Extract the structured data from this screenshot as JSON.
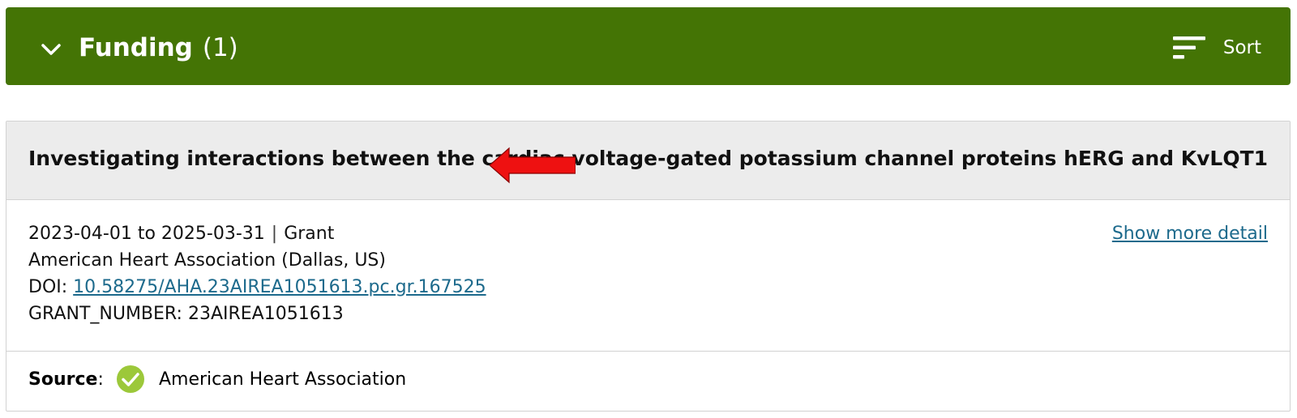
{
  "section": {
    "title": "Funding",
    "count": "(1)",
    "header_color": "#447405",
    "sort_label": "Sort",
    "icons": {
      "collapse": "chevron-down-icon",
      "sort": "sort-lines-icon"
    }
  },
  "funding_item": {
    "title": "Investigating interactions between the cardiac voltage-gated potassium channel proteins hERG and KvLQT1",
    "date_range": "2023-04-01 to 2025-03-31",
    "separator": "|",
    "type": "Grant",
    "organization": "American Heart Association (Dallas, US)",
    "doi_label": "DOI:",
    "doi_value": "10.58275/AHA.23AIREA1051613.pc.gr.167525",
    "grant_number_label": "GRANT_NUMBER:",
    "grant_number_value": "23AIREA1051613",
    "show_more_label": "Show more detail",
    "link_color": "#1d6a8c",
    "source_label": "Source",
    "source_colon": ":",
    "source_name": "American Heart Association",
    "source_icon": "check-circle-icon",
    "source_icon_color": "#9cc83a",
    "annotation_arrow_color": "#ee1111"
  }
}
